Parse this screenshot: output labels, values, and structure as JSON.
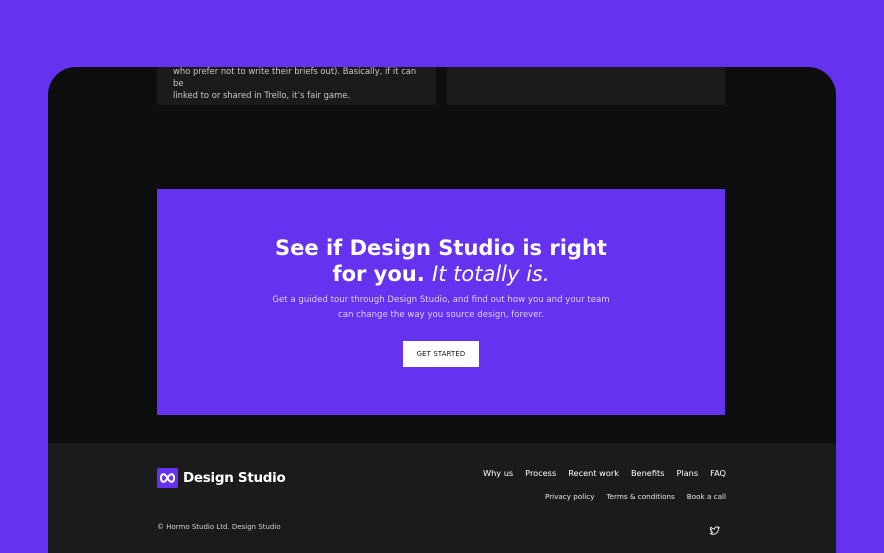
{
  "faq_card": {
    "text_line1": "who prefer not to write their briefs out). Basically, if it can be",
    "text_line2": "linked to or shared in Trello, it’s fair game."
  },
  "cta": {
    "title_part1": "See if Design Studio is right",
    "title_part2": "for you.",
    "title_emphasis": "It totally is.",
    "subtitle_line1": "Get a guided tour through Design Studio, and find out how you and your team",
    "subtitle_line2": "can change the way you source design, forever.",
    "button_label": "GET STARTED"
  },
  "footer": {
    "logo_text": "Design Studio",
    "nav_main": [
      "Why us",
      "Process",
      "Recent work",
      "Benefits",
      "Plans",
      "FAQ"
    ],
    "nav_secondary": [
      "Privacy policy",
      "Terms & conditions",
      "Book a call"
    ],
    "copyright": "© Hormo Studio Ltd. Design Studio",
    "social_icon": "twitter-icon"
  },
  "colors": {
    "brand": "#6532ef",
    "device_bg": "#0e0e0e",
    "surface": "#1b1b1b",
    "text_primary": "#ffffff"
  }
}
